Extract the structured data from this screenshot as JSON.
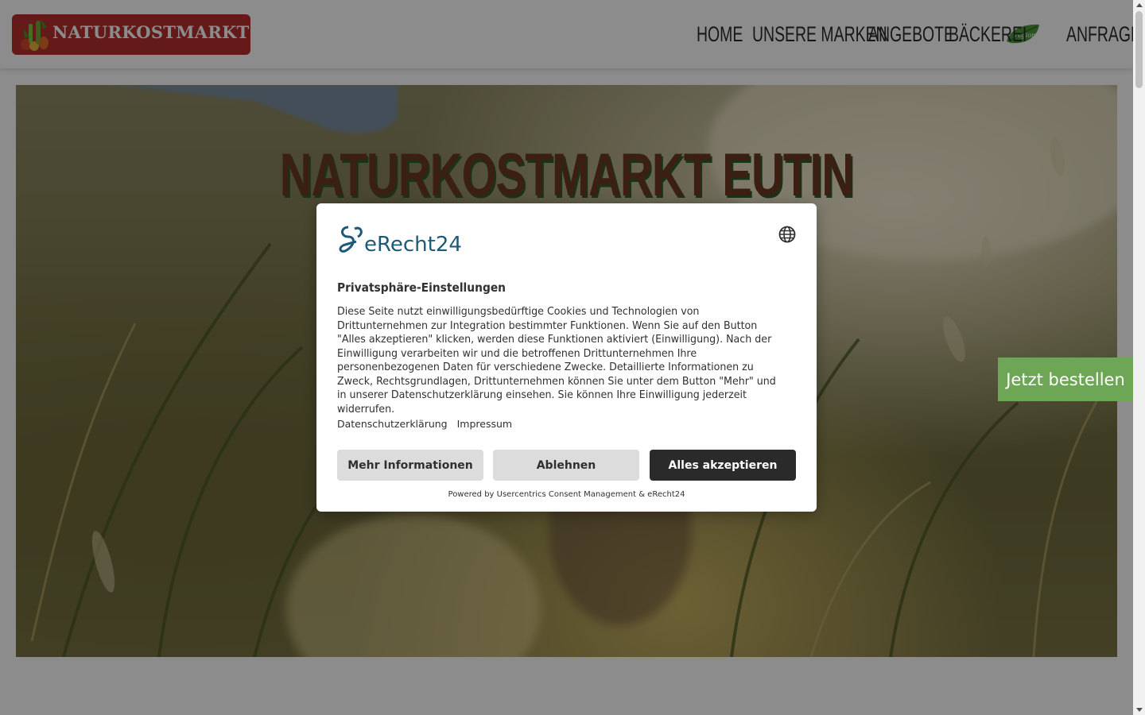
{
  "header": {
    "logo_text": "NATURKOSTMARKT",
    "nav": [
      "HOME",
      "UNSERE MARKEN",
      "ANGEBOTE",
      "BÄCKEREI",
      "ANFRAGE"
    ],
    "badge_text": "regional"
  },
  "hero": {
    "title": "NATURKOSTMARKT EUTIN"
  },
  "order_button": "Jetzt bestellen",
  "consent": {
    "brand": "eRecht24",
    "title": "Privatsphäre-Einstellungen",
    "body": "Diese Seite nutzt einwilligungsbedürftige Cookies und Technologien von Drittunternehmen zur Integration bestimmter Funktionen. Wenn Sie auf den Button \"Alles akzeptieren\" klicken, werden diese Funktionen aktiviert (Einwilligung). Nach der Einwilligung verarbeiten wir und die betroffenen Drittunternehmen Ihre personenbezogenen Daten für verschiedene Zwecke. Detaillierte Informationen zu Zweck, Rechtsgrundlagen, Drittunternehmen können Sie unter dem Button \"Mehr\" und in unserer Datenschutzerklärung einsehen. Sie können Ihre Einwilligung jederzeit widerrufen.",
    "links": [
      "Datenschutzerklärung",
      "Impressum"
    ],
    "buttons": {
      "more": "Mehr Informationen",
      "deny": "Ablehnen",
      "accept": "Alles akzeptieren"
    },
    "powered_by": "Powered by Usercentrics Consent Management & eRecht24"
  },
  "colors": {
    "logo_bg": "#b5312c",
    "order_button": "#6da654",
    "accept_button": "#2a2a2a",
    "secondary_button": "#dcdcdc",
    "brand_blue": "#1e5a78"
  },
  "icons": [
    "vegetables-logo-icon",
    "regional-leaf-icon",
    "globe-icon",
    "erecht24-logo-icon"
  ]
}
